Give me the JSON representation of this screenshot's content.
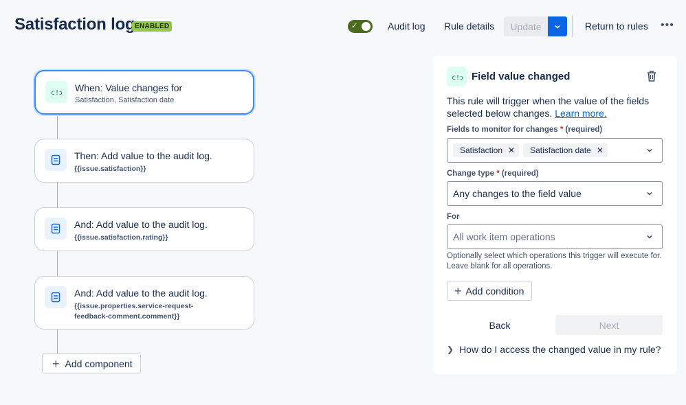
{
  "header": {
    "title": "Satisfaction log",
    "status": "ENABLED",
    "toggle_on": true,
    "audit_log": "Audit log",
    "rule_details": "Rule details",
    "update": "Update",
    "return_to_rules": "Return to rules",
    "more": "•••"
  },
  "flow": {
    "cards": [
      {
        "title": "When: Value changes for",
        "subtitle": "Satisfaction, Satisfaction date",
        "icon": "trigger-icon"
      },
      {
        "title": "Then: Add value to the audit log.",
        "subtitle": "{{issue.satisfaction}}",
        "icon": "audit-log-icon"
      },
      {
        "title": "And: Add value to the audit log.",
        "subtitle": "{{issue.satisfaction.rating}}",
        "icon": "audit-log-icon"
      },
      {
        "title": "And: Add value to the audit log.",
        "subtitle": "{{issue.properties.service-request-feedback-comment.comment}}",
        "icon": "audit-log-icon"
      }
    ],
    "add_component": "Add component"
  },
  "panel": {
    "title": "Field value changed",
    "description": "This rule will trigger when the value of the fields selected below changes.",
    "learn_more": "Learn more.",
    "fields_label": "Fields to monitor for changes",
    "required_marker": "*",
    "required_text": "(required)",
    "selected_fields": [
      "Satisfaction",
      "Satisfaction date"
    ],
    "change_type_label": "Change type",
    "change_type_value": "Any changes to the field value",
    "for_label": "For",
    "for_placeholder": "All work item operations",
    "help_text": "Optionally select which operations this trigger will execute for. Leave blank for all operations.",
    "add_condition": "Add condition",
    "back": "Back",
    "next": "Next",
    "expander": "How do I access the changed value in my rule?"
  },
  "colors": {
    "accent": "#0c66e4",
    "enabled_lozenge": "#94c748",
    "toggle_on": "#4c6b1f",
    "trigger_icon_bg": "#dcfff1",
    "action_icon_bg": "#e9f2ff"
  }
}
